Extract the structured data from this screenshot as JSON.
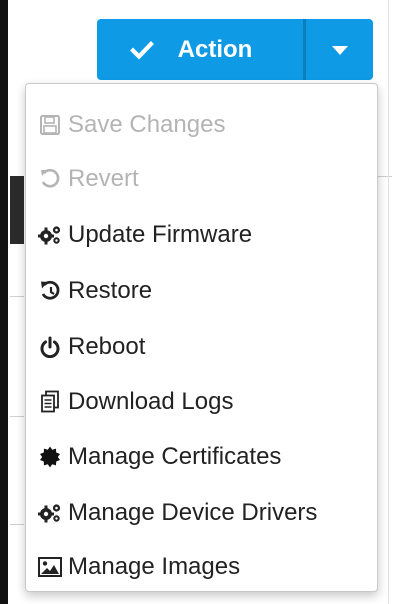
{
  "action_button": {
    "label": "Action",
    "icon": "check-icon",
    "caret_icon": "caret-down-icon",
    "color": "#0f9ae6"
  },
  "menu": {
    "items": [
      {
        "label": "Save Changes",
        "icon": "floppy-disk-icon",
        "enabled": false
      },
      {
        "label": "Revert",
        "icon": "undo-icon",
        "enabled": false
      },
      {
        "label": "Update Firmware",
        "icon": "gears-icon",
        "enabled": true
      },
      {
        "label": "Restore",
        "icon": "history-icon",
        "enabled": true
      },
      {
        "label": "Reboot",
        "icon": "power-icon",
        "enabled": true
      },
      {
        "label": "Download Logs",
        "icon": "files-icon",
        "enabled": true
      },
      {
        "label": "Manage Certificates",
        "icon": "certificate-icon",
        "enabled": true
      },
      {
        "label": "Manage Device Drivers",
        "icon": "gears-icon",
        "enabled": true
      },
      {
        "label": "Manage Images",
        "icon": "image-icon",
        "enabled": true
      }
    ]
  }
}
